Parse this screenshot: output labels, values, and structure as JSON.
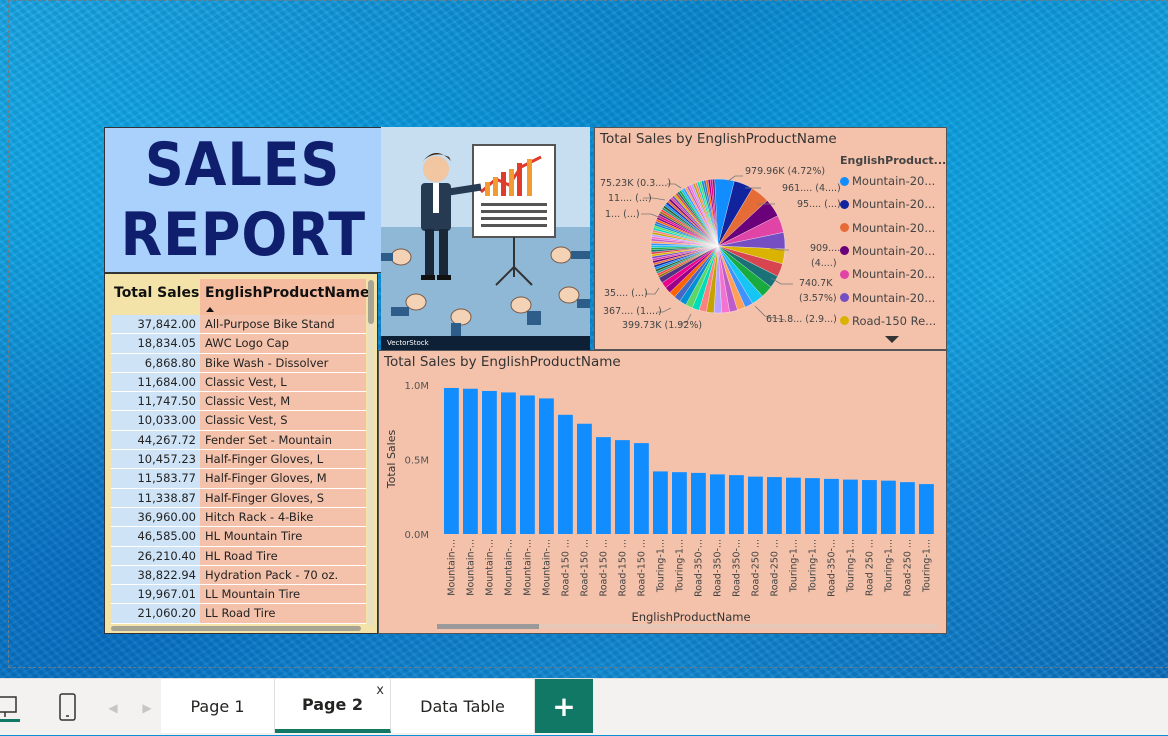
{
  "report": {
    "title_line1": "SALES",
    "title_line2": "REPORT",
    "image_credit": "VectorStock"
  },
  "pie_chart": {
    "title": "Total Sales by EnglishProductName",
    "legend_title": "EnglishProduct...",
    "slice_labels": {
      "l1": "979.96K (4.72%)",
      "l2": "961.... (4....)",
      "l3": "95.... (...)",
      "l4a": "909....",
      "l4b": "(4....)",
      "l5a": "740.7K",
      "l5b": "(3.57%)",
      "l6": "611.8... (2.9...)",
      "l7": "399.73K (1.92%)",
      "l8": "367.... (1....)",
      "l9": "35.... (...)",
      "l10": "1... (...)",
      "l11": "11.... (...)",
      "l12": "75.23K (0.3....)"
    },
    "legend": [
      {
        "label": "Mountain-20...",
        "color": "#118dff"
      },
      {
        "label": "Mountain-20...",
        "color": "#12239e"
      },
      {
        "label": "Mountain-20...",
        "color": "#e66c37"
      },
      {
        "label": "Mountain-20...",
        "color": "#6b007b"
      },
      {
        "label": "Mountain-20...",
        "color": "#e044a7"
      },
      {
        "label": "Mountain-20...",
        "color": "#744ec2"
      },
      {
        "label": "Road-150 Re...",
        "color": "#d9b300"
      }
    ]
  },
  "table": {
    "col1_header": "Total Sales",
    "col2_header": "EnglishProductName",
    "rows": [
      {
        "sales": "37,842.00",
        "name": "All-Purpose Bike Stand"
      },
      {
        "sales": "18,834.05",
        "name": "AWC Logo Cap"
      },
      {
        "sales": "6,868.80",
        "name": "Bike Wash - Dissolver"
      },
      {
        "sales": "11,684.00",
        "name": "Classic Vest, L"
      },
      {
        "sales": "11,747.50",
        "name": "Classic Vest, M"
      },
      {
        "sales": "10,033.00",
        "name": "Classic Vest, S"
      },
      {
        "sales": "44,267.72",
        "name": "Fender Set - Mountain"
      },
      {
        "sales": "10,457.23",
        "name": "Half-Finger Gloves, L"
      },
      {
        "sales": "11,583.77",
        "name": "Half-Finger Gloves, M"
      },
      {
        "sales": "11,338.87",
        "name": "Half-Finger Gloves, S"
      },
      {
        "sales": "36,960.00",
        "name": "Hitch Rack - 4-Bike"
      },
      {
        "sales": "46,585.00",
        "name": "HL Mountain Tire"
      },
      {
        "sales": "26,210.40",
        "name": "HL Road Tire"
      },
      {
        "sales": "38,822.94",
        "name": "Hydration Pack - 70 oz."
      },
      {
        "sales": "19,967.01",
        "name": "LL Mountain Tire"
      },
      {
        "sales": "21,060.20",
        "name": "LL Road Tire"
      }
    ]
  },
  "chart_data": {
    "type": "bar",
    "title": "Total Sales by EnglishProductName",
    "xlabel": "EnglishProductName",
    "ylabel": "Total Sales",
    "ylim": [
      0,
      1.0
    ],
    "y_ticks": [
      "1.0M",
      "0.5M",
      "0.0M"
    ],
    "color": "#118dff",
    "categories": [
      "Mountain-...",
      "Mountain-...",
      "Mountain-...",
      "Mountain-...",
      "Mountain-...",
      "Mountain-...",
      "Road-150 ...",
      "Road-150 ...",
      "Road-150 ...",
      "Road-150 ...",
      "Road-150 ...",
      "Touring-1...",
      "Touring-1...",
      "Road-350-...",
      "Road-350-...",
      "Road-350-...",
      "Road-250 ...",
      "Road-250 ...",
      "Touring-1...",
      "Touring-1...",
      "Road-350-...",
      "Touring-1...",
      "Road 250 ...",
      "Touring-1...",
      "Road-250 ...",
      "Touring-1..."
    ],
    "values": [
      0.98,
      0.975,
      0.96,
      0.95,
      0.93,
      0.91,
      0.8,
      0.74,
      0.65,
      0.63,
      0.61,
      0.42,
      0.415,
      0.41,
      0.4,
      0.395,
      0.385,
      0.382,
      0.378,
      0.375,
      0.37,
      0.365,
      0.362,
      0.358,
      0.348,
      0.335
    ]
  },
  "tabs": {
    "page1": "Page 1",
    "page2": "Page 2",
    "data_table": "Data Table",
    "close": "x",
    "add": "+"
  }
}
